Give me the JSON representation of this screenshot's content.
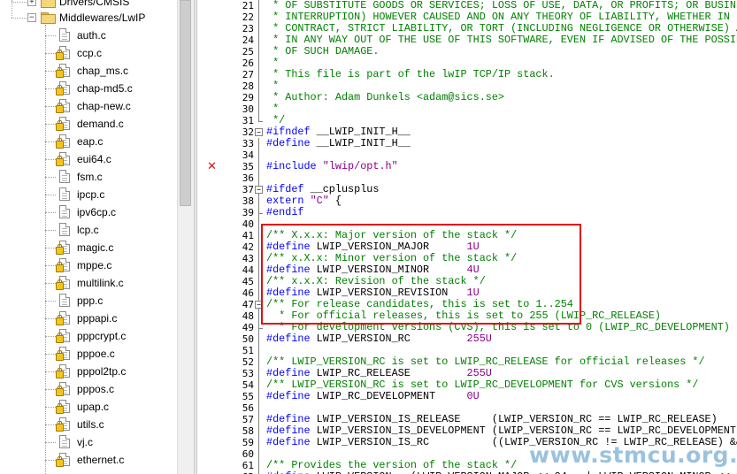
{
  "tree": {
    "groups": [
      {
        "label": "Drivers/CMSIS",
        "expander": "+"
      },
      {
        "label": "Middlewares/LwIP",
        "expander": "−"
      }
    ],
    "files": [
      {
        "name": "auth.c",
        "locked": false
      },
      {
        "name": "ccp.c",
        "locked": true
      },
      {
        "name": "chap_ms.c",
        "locked": true
      },
      {
        "name": "chap-md5.c",
        "locked": true
      },
      {
        "name": "chap-new.c",
        "locked": true
      },
      {
        "name": "demand.c",
        "locked": true
      },
      {
        "name": "eap.c",
        "locked": true
      },
      {
        "name": "eui64.c",
        "locked": true
      },
      {
        "name": "fsm.c",
        "locked": false
      },
      {
        "name": "ipcp.c",
        "locked": false
      },
      {
        "name": "ipv6cp.c",
        "locked": false
      },
      {
        "name": "lcp.c",
        "locked": false
      },
      {
        "name": "magic.c",
        "locked": true
      },
      {
        "name": "mppe.c",
        "locked": true
      },
      {
        "name": "multilink.c",
        "locked": true
      },
      {
        "name": "ppp.c",
        "locked": false
      },
      {
        "name": "pppapi.c",
        "locked": true
      },
      {
        "name": "pppcrypt.c",
        "locked": true
      },
      {
        "name": "pppoe.c",
        "locked": true
      },
      {
        "name": "pppol2tp.c",
        "locked": true
      },
      {
        "name": "pppos.c",
        "locked": true
      },
      {
        "name": "upap.c",
        "locked": true
      },
      {
        "name": "utils.c",
        "locked": true
      },
      {
        "name": "vj.c",
        "locked": false
      },
      {
        "name": "ethernet.c",
        "locked": true
      }
    ]
  },
  "editor": {
    "breakpoint_line": "35",
    "lines": [
      {
        "n": "21",
        "t": " * OF SUBSTITUTE GOODS OR SERVICES; LOSS OF USE, DATA, OR PROFITS; OR BUSINESS",
        "cls": "c"
      },
      {
        "n": "22",
        "t": " * INTERRUPTION) HOWEVER CAUSED AND ON ANY THEORY OF LIABILITY, WHETHER IN",
        "cls": "c"
      },
      {
        "n": "23",
        "t": " * CONTRACT, STRICT LIABILITY, OR TORT (INCLUDING NEGLIGENCE OR OTHERWISE) ARISING",
        "cls": "c"
      },
      {
        "n": "24",
        "t": " * IN ANY WAY OUT OF THE USE OF THIS SOFTWARE, EVEN IF ADVISED OF THE POSSIBILITY",
        "cls": "c"
      },
      {
        "n": "25",
        "t": " * OF SUCH DAMAGE.",
        "cls": "c"
      },
      {
        "n": "26",
        "t": " *",
        "cls": "c"
      },
      {
        "n": "27",
        "t": " * This file is part of the lwIP TCP/IP stack.",
        "cls": "c"
      },
      {
        "n": "28",
        "t": " *",
        "cls": "c"
      },
      {
        "n": "29",
        "t": " * Author: Adam Dunkels <adam@sics.se>",
        "cls": "c"
      },
      {
        "n": "30",
        "t": " *",
        "cls": "c"
      },
      {
        "n": "31",
        "t": " */",
        "cls": "c"
      },
      {
        "n": "32",
        "t": "#ifndef __LWIP_INIT_H__",
        "cls": "pp"
      },
      {
        "n": "33",
        "t": "#define __LWIP_INIT_H__",
        "cls": "pp"
      },
      {
        "n": "34",
        "t": "",
        "cls": ""
      },
      {
        "n": "35",
        "t": "#include \"lwip/opt.h\"",
        "cls": "inc"
      },
      {
        "n": "36",
        "t": "",
        "cls": ""
      },
      {
        "n": "37",
        "t": "#ifdef __cplusplus",
        "cls": "pp"
      },
      {
        "n": "38",
        "t": "extern \"C\" {",
        "cls": "ext"
      },
      {
        "n": "39",
        "t": "#endif",
        "cls": "pp"
      },
      {
        "n": "40",
        "t": "",
        "cls": ""
      },
      {
        "n": "41",
        "t": "/** X.x.x: Major version of the stack */",
        "cls": "c"
      },
      {
        "n": "42",
        "t": "#define LWIP_VERSION_MAJOR      1U",
        "cls": "def"
      },
      {
        "n": "43",
        "t": "/** x.X.x: Minor version of the stack */",
        "cls": "c"
      },
      {
        "n": "44",
        "t": "#define LWIP_VERSION_MINOR      4U",
        "cls": "def"
      },
      {
        "n": "45",
        "t": "/** x.x.X: Revision of the stack */",
        "cls": "c"
      },
      {
        "n": "46",
        "t": "#define LWIP_VERSION_REVISION   1U",
        "cls": "def"
      },
      {
        "n": "47",
        "t": "/** For release candidates, this is set to 1..254",
        "cls": "c"
      },
      {
        "n": "48",
        "t": "  * For official releases, this is set to 255 (LWIP_RC_RELEASE)",
        "cls": "c"
      },
      {
        "n": "49",
        "t": "  * For development versions (CVS), this is set to 0 (LWIP_RC_DEVELOPMENT) */",
        "cls": "c"
      },
      {
        "n": "50",
        "t": "#define LWIP_VERSION_RC         255U",
        "cls": "def"
      },
      {
        "n": "51",
        "t": "",
        "cls": ""
      },
      {
        "n": "52",
        "t": "/** LWIP_VERSION_RC is set to LWIP_RC_RELEASE for official releases */",
        "cls": "c"
      },
      {
        "n": "53",
        "t": "#define LWIP_RC_RELEASE         255U",
        "cls": "def"
      },
      {
        "n": "54",
        "t": "/** LWIP_VERSION_RC is set to LWIP_RC_DEVELOPMENT for CVS versions */",
        "cls": "c"
      },
      {
        "n": "55",
        "t": "#define LWIP_RC_DEVELOPMENT     0U",
        "cls": "def"
      },
      {
        "n": "56",
        "t": "",
        "cls": ""
      },
      {
        "n": "57",
        "t": "#define LWIP_VERSION_IS_RELEASE     (LWIP_VERSION_RC == LWIP_RC_RELEASE)",
        "cls": "pp"
      },
      {
        "n": "58",
        "t": "#define LWIP_VERSION_IS_DEVELOPMENT (LWIP_VERSION_RC == LWIP_RC_DEVELOPMENT)",
        "cls": "pp"
      },
      {
        "n": "59",
        "t": "#define LWIP_VERSION_IS_RC          ((LWIP_VERSION_RC != LWIP_RC_RELEASE) && (LWIP_",
        "cls": "pp"
      },
      {
        "n": "60",
        "t": "",
        "cls": ""
      },
      {
        "n": "61",
        "t": "/** Provides the version of the stack */",
        "cls": "c"
      },
      {
        "n": "62",
        "t": "#define LWIP_VERSION   (LWIP_VERSION_MAJOR << 24   | LWIP_VERSION_MINOR << 16 | \\",
        "cls": "pp"
      }
    ]
  },
  "watermark": "www.stmcu.org.cn",
  "colors": {
    "highlight": "#e01010",
    "comment": "#008000",
    "keyword": "#0000ff",
    "number": "#8b008b"
  }
}
